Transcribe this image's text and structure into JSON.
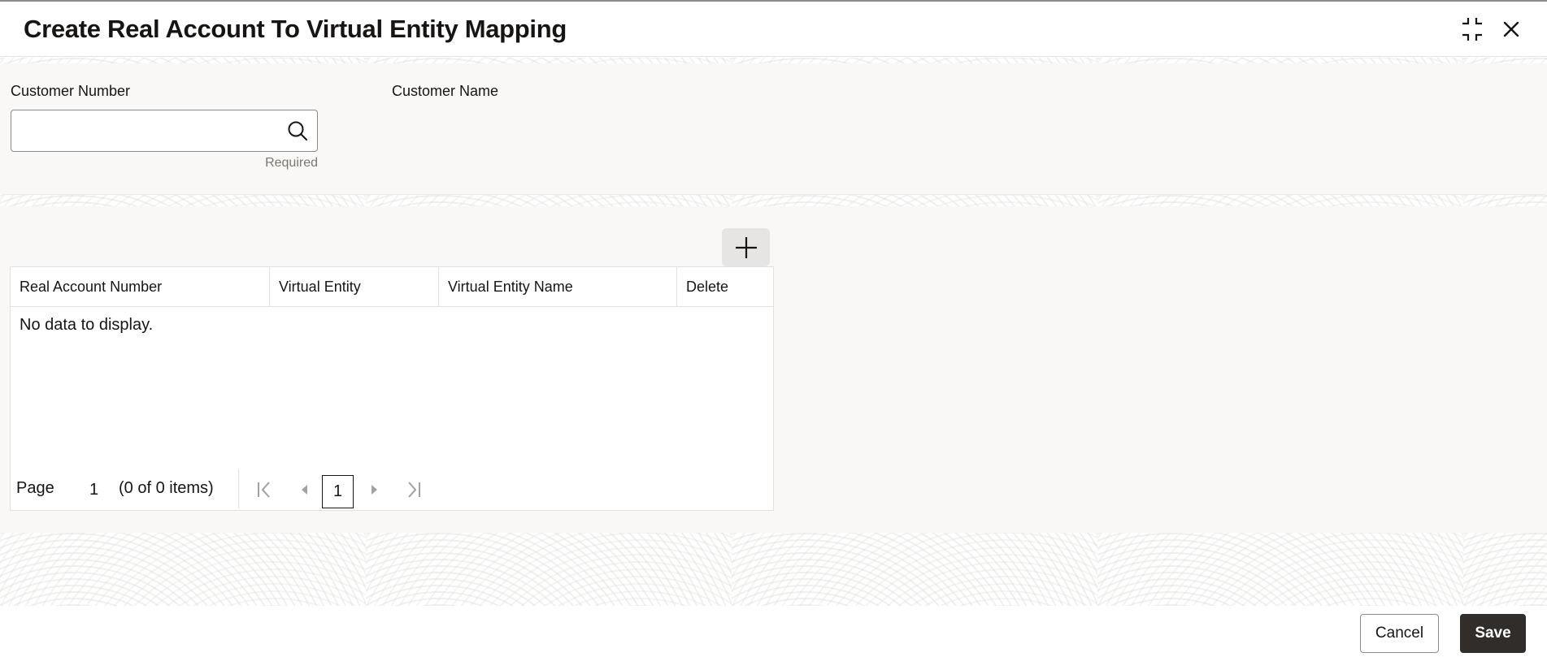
{
  "header": {
    "title": "Create Real Account To Virtual Entity Mapping",
    "icons": {
      "minimize": "minimize-icon",
      "close": "close-icon"
    }
  },
  "customer": {
    "customer_number_label": "Customer Number",
    "customer_number_value": "",
    "customer_number_placeholder": "",
    "customer_number_hint": "Required",
    "customer_name_label": "Customer Name",
    "customer_name_value": "",
    "search_icon": "search-icon"
  },
  "grid": {
    "add_icon": "plus-icon",
    "columns": [
      "Real Account Number",
      "Virtual Entity",
      "Virtual Entity Name",
      "Delete"
    ],
    "rows": [],
    "empty_message": "No data to display.",
    "pagination": {
      "page_label": "Page",
      "page_value": "1",
      "items_summary": "(0 of 0 items)",
      "current_page": "1"
    }
  },
  "footer": {
    "cancel_label": "Cancel",
    "save_label": "Save"
  },
  "colors": {
    "primary_button": "#312d2a",
    "panel_background": "#f9f8f6",
    "text": "#161513"
  }
}
